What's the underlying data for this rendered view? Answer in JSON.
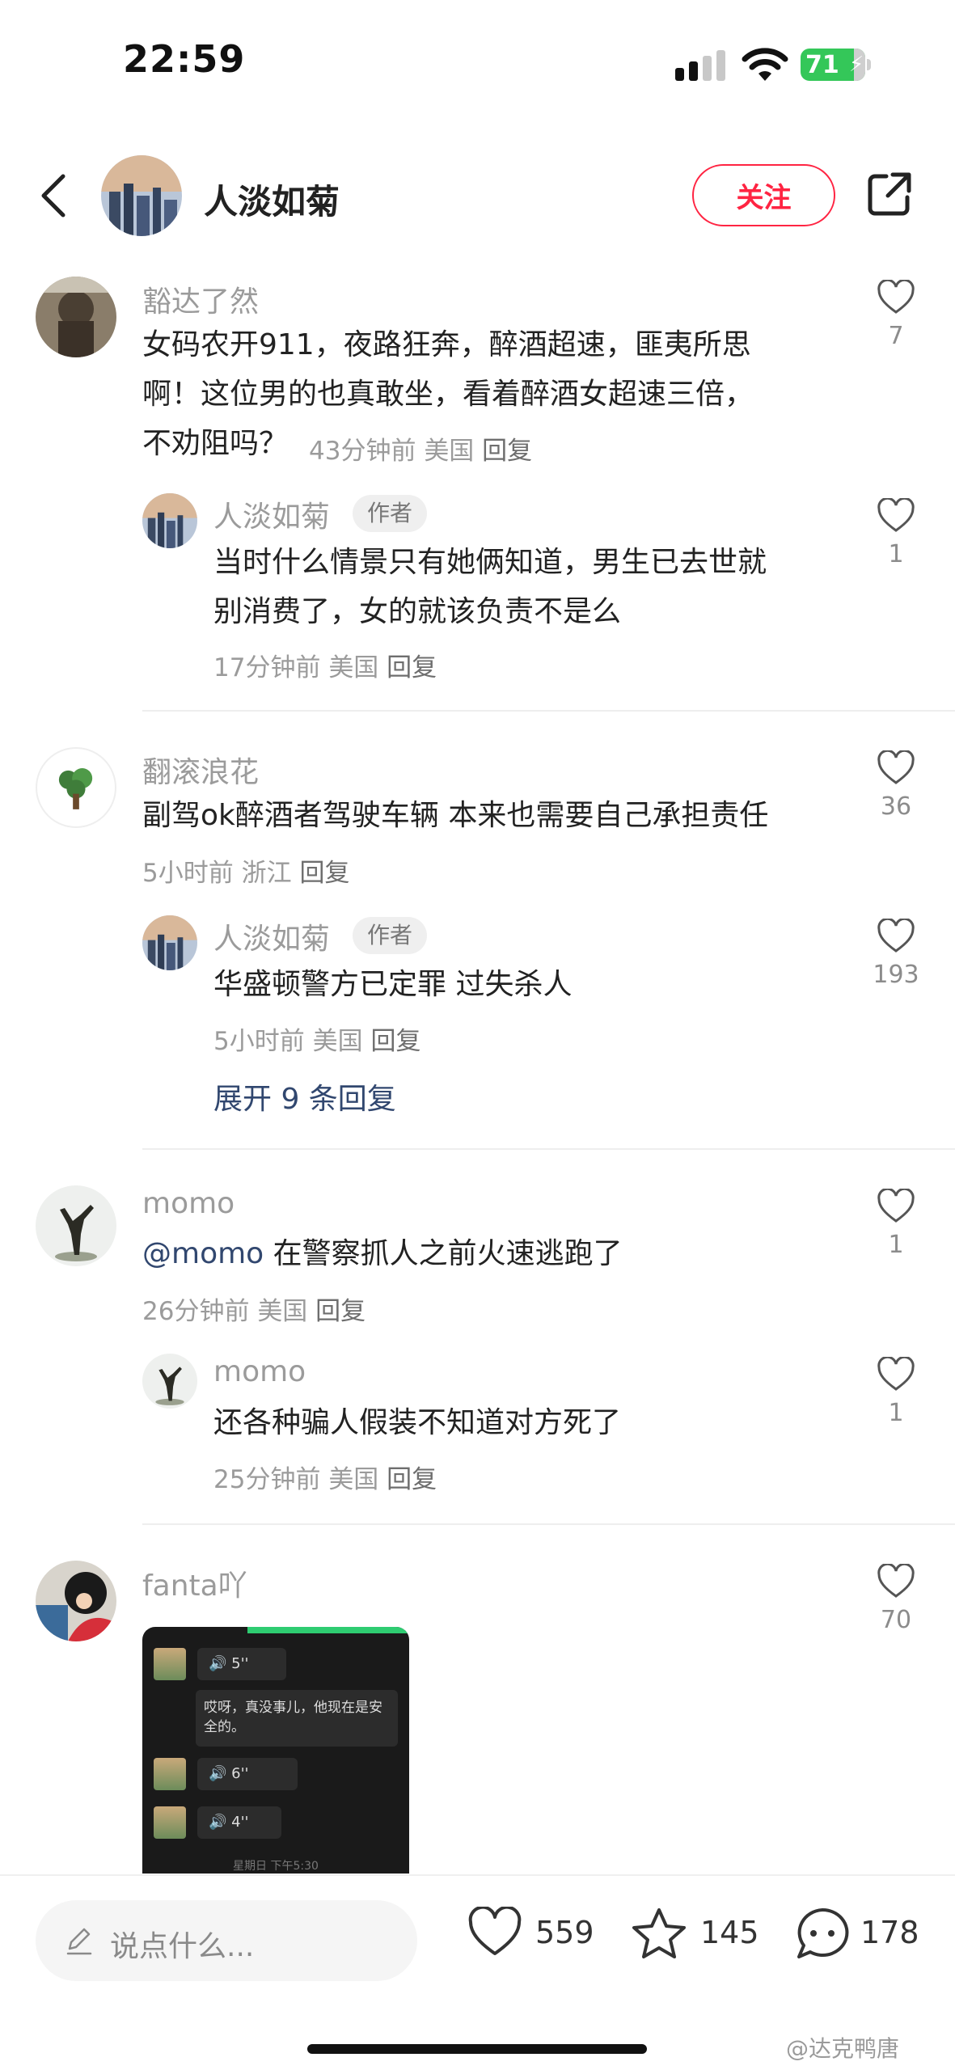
{
  "status_bar": {
    "time": "22:59",
    "battery": "71"
  },
  "header": {
    "author_name": "人淡如菊",
    "follow_label": "关注"
  },
  "comments": [
    {
      "user": "豁达了然",
      "text_lines": [
        "女码农开911，夜路狂奔，醉酒超速，匪夷所思",
        "啊！这位男的也真敢坐，看着醉酒女超速三倍，",
        "不劝阻吗？"
      ],
      "time": "43分钟前",
      "location": "美国",
      "reply": "回复",
      "likes": "7",
      "replies": [
        {
          "user": "人淡如菊",
          "tag": "作者",
          "text_lines": [
            "当时什么情景只有她俩知道，男生已去世就",
            "别消费了，女的就该负责不是么"
          ],
          "time": "17分钟前",
          "location": "美国",
          "reply": "回复",
          "likes": "1"
        }
      ]
    },
    {
      "user": "翻滚浪花",
      "text_lines": [
        "副驾ok醉酒者驾驶车辆 本来也需要自己承担责任"
      ],
      "time": "5小时前",
      "location": "浙江",
      "reply": "回复",
      "likes": "36",
      "replies": [
        {
          "user": "人淡如菊",
          "tag": "作者",
          "text_lines": [
            "华盛顿警方已定罪 过失杀人"
          ],
          "time": "5小时前",
          "location": "美国",
          "reply": "回复",
          "likes": "193"
        }
      ],
      "expand_label": "展开 9 条回复"
    },
    {
      "user": "momo",
      "mention": "@momo",
      "text_lines": [
        "在警察抓人之前火速逃跑了"
      ],
      "time": "26分钟前",
      "location": "美国",
      "reply": "回复",
      "likes": "1",
      "replies": [
        {
          "user": "momo",
          "text_lines": [
            "还各种骗人假装不知道对方死了"
          ],
          "time": "25分钟前",
          "location": "美国",
          "reply": "回复",
          "likes": "1"
        }
      ]
    },
    {
      "user": "fanta吖",
      "likes": "70",
      "image": {
        "voice_1": "5''",
        "chat_text": "哎呀，真没事儿，他现在是安全的。",
        "voice_2": "6''",
        "voice_3": "4''",
        "timestamp": "星期日 下午5:30"
      }
    }
  ],
  "bottom_bar": {
    "input_placeholder": "说点什么...",
    "likes": "559",
    "favorites": "145",
    "comments": "178"
  },
  "watermark": "@达克鸭唐",
  "colors": {
    "accent": "#ff2442",
    "link": "#31476f",
    "battery": "#34c759"
  }
}
